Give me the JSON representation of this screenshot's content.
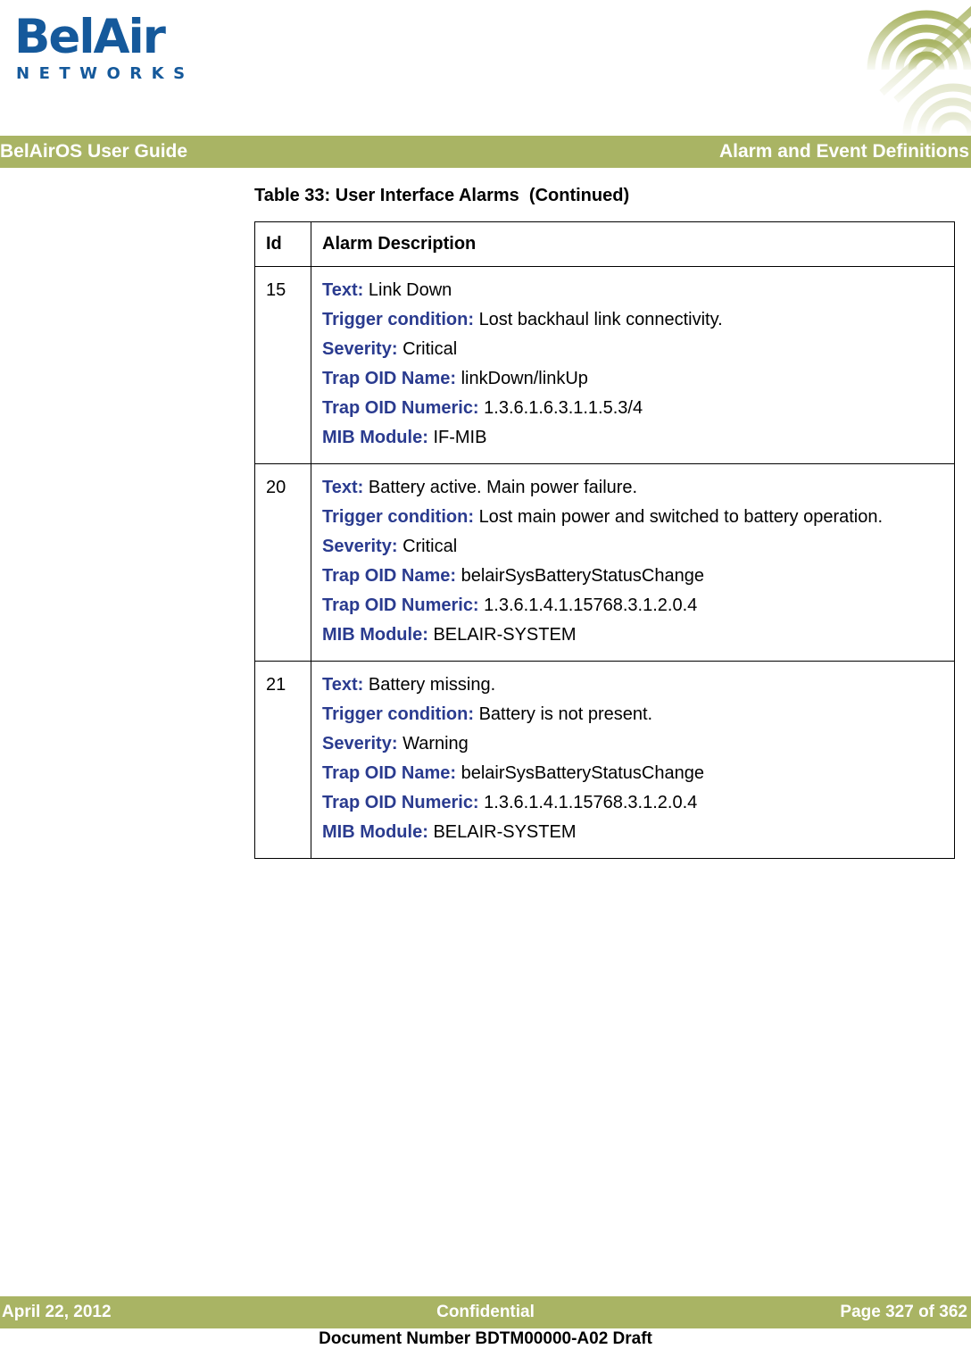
{
  "brand": {
    "logo_wordmark": "BelAir",
    "logo_subword": "NETWORKS",
    "logo_color": "#15599B",
    "band_color": "#A9B464",
    "label_color": "#2A3B8F",
    "corner_graphic": "radiating-arcs-graphic"
  },
  "header": {
    "left_title": "BelAirOS User Guide",
    "right_title": "Alarm and Event Definitions"
  },
  "main": {
    "table_caption": "Table 33: User Interface Alarms  (Continued)",
    "columns": [
      "Id",
      "Alarm Description"
    ],
    "field_labels": {
      "text": "Text:",
      "trigger": "Trigger condition:",
      "severity": "Severity:",
      "trap_name": "Trap OID Name:",
      "trap_numeric": "Trap OID Numeric:",
      "mib": "MIB Module:"
    },
    "rows": [
      {
        "id": "15",
        "text": "Link Down",
        "trigger": "Lost backhaul link connectivity.",
        "severity": "Critical",
        "trap_name": "linkDown/linkUp",
        "trap_numeric": "1.3.6.1.6.3.1.1.5.3/4",
        "mib": "IF-MIB"
      },
      {
        "id": "20",
        "text": "Battery active. Main power failure.",
        "trigger": "Lost main power and switched to battery operation.",
        "severity": "Critical",
        "trap_name": "belairSysBatteryStatusChange",
        "trap_numeric": "1.3.6.1.4.1.15768.3.1.2.0.4",
        "mib": "BELAIR-SYSTEM"
      },
      {
        "id": "21",
        "text": "Battery missing.",
        "trigger": "Battery is not present.",
        "severity": "Warning",
        "trap_name": "belairSysBatteryStatusChange",
        "trap_numeric": "1.3.6.1.4.1.15768.3.1.2.0.4",
        "mib": "BELAIR-SYSTEM"
      }
    ]
  },
  "footer": {
    "date": "April 22, 2012",
    "classification": "Confidential",
    "page": "Page 327 of 362",
    "document_number": "Document Number BDTM00000-A02 Draft"
  }
}
